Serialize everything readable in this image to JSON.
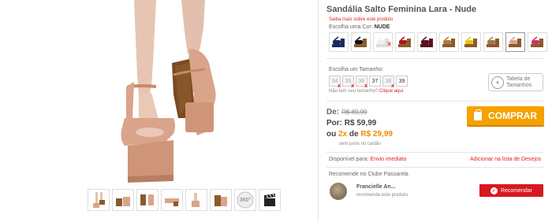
{
  "product": {
    "title": "Sandália Salto Feminina Lara - Nude",
    "more_link": "Saiba mais sobre este produto",
    "color_label": "Escolha uma Cor:",
    "selected_color": "NUDE"
  },
  "colors": [
    {
      "name": "marinho",
      "hex": "#1b2a5c",
      "sole": "#1b2a5c",
      "available": true
    },
    {
      "name": "preto",
      "hex": "#111111",
      "sole": "#8b5a2b",
      "available": true
    },
    {
      "name": "branco",
      "hex": "#f1f1f1",
      "sole": "#dddddd",
      "available": false
    },
    {
      "name": "vermelho",
      "hex": "#b01515",
      "sole": "#8b5a2b",
      "available": true
    },
    {
      "name": "vinho",
      "hex": "#5a1020",
      "sole": "#5a1020",
      "available": true
    },
    {
      "name": "caramelo",
      "hex": "#b5763a",
      "sole": "#8b5a2b",
      "available": true
    },
    {
      "name": "amarelo",
      "hex": "#e6c700",
      "sole": "#8b5a2b",
      "available": true
    },
    {
      "name": "onca",
      "hex": "#a07a45",
      "sole": "#8b5a2b",
      "available": true
    },
    {
      "name": "nude",
      "hex": "#d9a48a",
      "sole": "#8b5a2b",
      "available": true
    },
    {
      "name": "pink",
      "hex": "#d1306a",
      "sole": "#8b5a2b",
      "available": true
    }
  ],
  "size": {
    "label": "Escolha um Tamanho:",
    "options": [
      {
        "value": "34",
        "available": false
      },
      {
        "value": "35",
        "available": false
      },
      {
        "value": "36",
        "available": false
      },
      {
        "value": "37",
        "available": true
      },
      {
        "value": "38",
        "available": false
      },
      {
        "value": "39",
        "available": true
      }
    ],
    "help_text": "Não tem seu tamanho?",
    "help_link": "Clique aqui.",
    "table_line1": "Tabela de",
    "table_line2": "Tamanhos",
    "table_icon": "ruler-icon"
  },
  "price": {
    "de_label": "De:",
    "de_value": "R$ 89,99",
    "por_label": "Por:",
    "por_value": "R$ 59,99",
    "install_prefix": "ou",
    "install_count": "2x",
    "install_mid": "de",
    "install_value": "R$ 29,99",
    "note": "sem juros no cartão"
  },
  "buy_button": "COMPRAR",
  "availability": {
    "label": "Disponível para:",
    "value": "Envio imediato",
    "wishlist": "Adicionar na lista de Desejos"
  },
  "club": {
    "title": "Recomende no Clube Passarela",
    "user": "Francielle An...",
    "user_text": "recomenda este produto",
    "button": "Recomendar"
  },
  "accent": {
    "red": "#d71920",
    "orange": "#f5a100",
    "nude": "#d9a48a"
  }
}
